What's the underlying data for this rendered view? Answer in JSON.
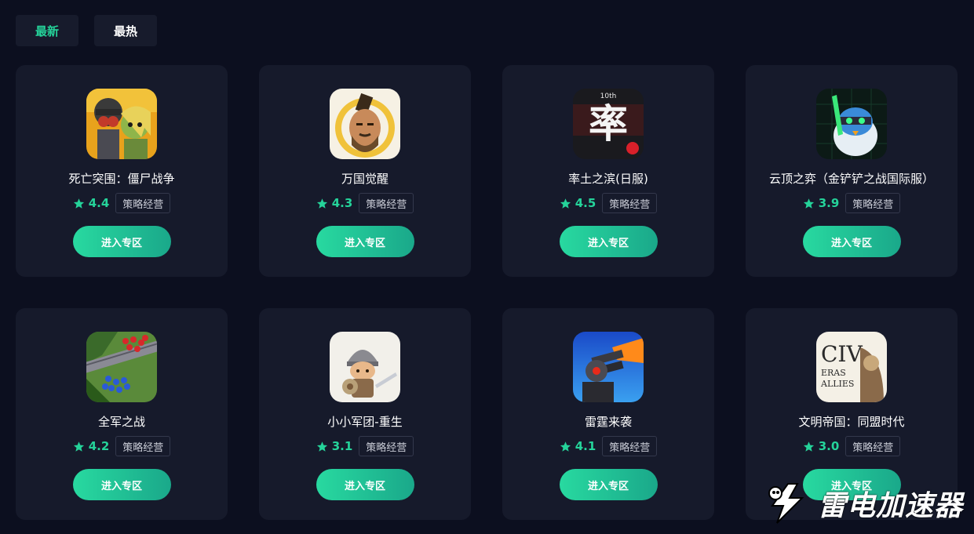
{
  "tabs": [
    {
      "label": "最新",
      "active": true
    },
    {
      "label": "最热",
      "active": false
    }
  ],
  "accent_color": "#25d39a",
  "games": [
    {
      "title": "死亡突围：僵尸战争",
      "rating": "4.4",
      "genre": "策略经营",
      "button": "进入专区",
      "icon": "zombie-soldier-icon"
    },
    {
      "title": "万国觉醒",
      "rating": "4.3",
      "genre": "策略经营",
      "button": "进入专区",
      "icon": "warrior-general-icon"
    },
    {
      "title": "率土之滨(日服)",
      "rating": "4.5",
      "genre": "策略经营",
      "button": "进入专区",
      "icon": "shuaitu-logo-icon"
    },
    {
      "title": "云顶之弈（金铲铲之战国际服）",
      "rating": "3.9",
      "genre": "策略经营",
      "button": "进入专区",
      "icon": "penguin-knight-icon"
    },
    {
      "title": "全军之战",
      "rating": "4.2",
      "genre": "策略经营",
      "button": "进入专区",
      "icon": "army-battlefield-icon"
    },
    {
      "title": "小小军团-重生",
      "rating": "3.1",
      "genre": "策略经营",
      "button": "进入专区",
      "icon": "little-knight-icon"
    },
    {
      "title": "雷霆来袭",
      "rating": "4.1",
      "genre": "策略经营",
      "button": "进入专区",
      "icon": "cannon-turret-icon"
    },
    {
      "title": "文明帝国：同盟时代",
      "rating": "3.0",
      "genre": "策略经营",
      "button": "进入专区",
      "icon": "civ-logo-icon"
    }
  ],
  "icon_text": {
    "shuaitu_top": "10th",
    "shuaitu_char": "率",
    "civ_main": "CIV",
    "civ_sub1": "ERAS",
    "civ_sub2": "ALLIES"
  },
  "watermark": {
    "text": "雷电加速器"
  }
}
